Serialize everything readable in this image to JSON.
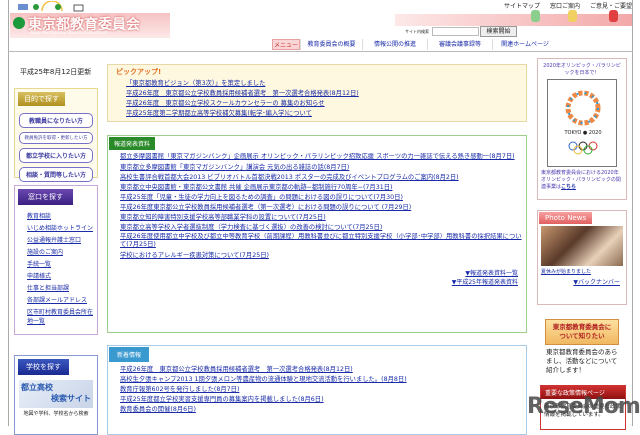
{
  "header": {
    "title": "東京都教育委員会",
    "subtitle": "Tokyo Metropolitan Board of Education",
    "toplinks": [
      "サイトマップ",
      "窓口ご案内",
      "ご意見・ご要望"
    ],
    "search_label": "サイト内検索",
    "search_placeholder": "",
    "search_button": "検索開始"
  },
  "nav": [
    "メニュー",
    "教育委員会の概要",
    "情報公開の推進",
    "審議会議事録等",
    "関連ホームページ"
  ],
  "left": {
    "updated": "平成25年8月12日更新",
    "purpose": {
      "title": "目的で探す",
      "items": [
        "教職員になりたい方",
        "教員免許を取得・更新したい方",
        "都立学校に入りたい方",
        "相談・質問等したい方"
      ]
    },
    "window": {
      "title": "窓口を探す",
      "items": [
        "教育相談",
        "いじめ相談ホットライン",
        "公益通報弁護士窓口",
        "施設のご案内",
        "手続一覧",
        "申請様式",
        "仕事と担当部課",
        "各部課メールアドレス",
        "区市町村教育委員会所在地一覧"
      ]
    },
    "school": {
      "title": "学校を探す",
      "banner_line1": "都立高校",
      "banner_line2": "検索サイト",
      "caption": "地図や学科、学校名から検索"
    }
  },
  "pickup": {
    "title": "ピックアップ!",
    "items": [
      "「東京都教育ビジョン（第3次）」を策定しました",
      "平成26年度　東京都公立学校教員採用候補者選考　第一次選考合格発表(8月12日)",
      "平成26年度　東京都公立学校スクールカウンセラーの 募集のお知らせ",
      "平成25年度第二学期都立高等学校補欠募集(転学･編入学)について"
    ]
  },
  "press": {
    "title": "報道発表資料",
    "items": [
      "都立多摩図書館「東京マガジンバンク」企画展示 オリンピック・パラリンピック招致応援 スポーツの力一雑誌で伝える熱き感動一(8月7日)",
      "東京都立多摩図書館「東京マガジンバンク」講演会 元気の出る雑誌の話(8月7日)",
      "高校生書評合戦首都大会2013 ビブリオバトル首都決戦2013 ポスターの完成及びイベントプログラムのご案内(8月2日)",
      "東京都立中央図書館・東京都公文書館 共催 企画展示東京都の軌跡−都制施行70周年−(7月31日)",
      "平成25年度「児童・生徒の学力向上を図るための調査」の問題における図の誤りについて(7月30日)",
      "平成26年度東京都公立学校教員採用候補者選考（第一次選考）における問題の誤りについて (7月29日)",
      "東京都立知的障害特別支援学校高等部職業学科の設置について(7月25日)",
      "東京都立高等学校入学者選抜制度（学力検査に基づく選抜）の改善の検討について(7月25日)",
      "平成26年度使用都立中学校及び都立中等教育学校（前期課程）用教科書並びに都立特別支援学校（小学部･中学部）用教科書の採択結果について(7月25日)",
      "学校におけるアレルギー疾患対策について(7月25日)"
    ],
    "more": [
      "▼報道発表資料一覧",
      "▼平成25年報道発表資料"
    ]
  },
  "news": {
    "title": "新着情報",
    "items": [
      "平成26年度　東京都公立学校教員採用候補者選考　第一次選考合格発表(8月12日)",
      "高校生夕張キャンプ2013 1期夕張メロン等農産物の流通体験と現地交流活動を行いました。(8月8日)",
      "教育庁報第602号を発行しました(8月7日)",
      "平成25年度都立学校実習支援専門員の募集案内を掲載しました(8月6日)",
      "教育委員会の開催(8月6日)"
    ]
  },
  "right": {
    "olympic_title": "2020年オリンピック・パラリンピックを日本で！",
    "olympic_logo_text": "TOKYO 2020 CANDIDATE CITY",
    "olympic_text": "東京都教育委員会における2020年オリンピック・パラリンピックの関連事業は",
    "olympic_link": "こちら",
    "photo_title": "Photo News",
    "photo_caption": "夏休みが始まりました",
    "backnumber": "▼バックナンバー",
    "about_button": "東京都教育委員会について知りたい",
    "about_text": "東京都教育委員会のあらまし、活動などについて紹介します！",
    "policy_title": "重要な政策情報ページ",
    "policy_text": "東京都教育委員会の重要な政策情報を掲載しています。"
  },
  "watermark": "ReseMom"
}
